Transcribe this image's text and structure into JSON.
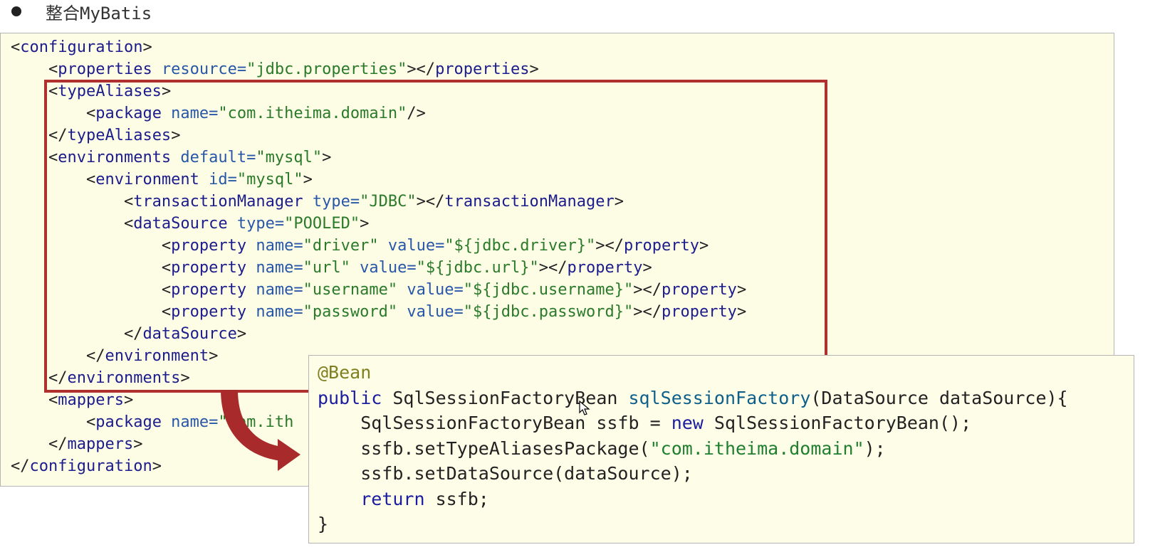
{
  "heading": {
    "text": "整合MyBatis"
  },
  "xml_config": {
    "lines": [
      [
        {
          "t": "<",
          "c": "b"
        },
        {
          "t": "configuration",
          "c": "t"
        },
        {
          "t": ">",
          "c": "b"
        }
      ],
      [
        {
          "t": "    <",
          "c": "b"
        },
        {
          "t": "properties",
          "c": "t"
        },
        {
          "t": " resource=",
          "c": "a"
        },
        {
          "t": "\"jdbc.properties\"",
          "c": "v"
        },
        {
          "t": "></",
          "c": "b"
        },
        {
          "t": "properties",
          "c": "t"
        },
        {
          "t": ">",
          "c": "b"
        }
      ],
      [
        {
          "t": "    <",
          "c": "b"
        },
        {
          "t": "typeAliases",
          "c": "t"
        },
        {
          "t": ">",
          "c": "b"
        }
      ],
      [
        {
          "t": "        <",
          "c": "b"
        },
        {
          "t": "package",
          "c": "t"
        },
        {
          "t": " name=",
          "c": "a"
        },
        {
          "t": "\"com.itheima.domain\"",
          "c": "v"
        },
        {
          "t": "/>",
          "c": "b"
        }
      ],
      [
        {
          "t": "    </",
          "c": "b"
        },
        {
          "t": "typeAliases",
          "c": "t"
        },
        {
          "t": ">",
          "c": "b"
        }
      ],
      [
        {
          "t": "    <",
          "c": "b"
        },
        {
          "t": "environments",
          "c": "t"
        },
        {
          "t": " default=",
          "c": "a"
        },
        {
          "t": "\"mysql\"",
          "c": "v"
        },
        {
          "t": ">",
          "c": "b"
        }
      ],
      [
        {
          "t": "        <",
          "c": "b"
        },
        {
          "t": "environment",
          "c": "t"
        },
        {
          "t": " id=",
          "c": "a"
        },
        {
          "t": "\"mysql\"",
          "c": "v"
        },
        {
          "t": ">",
          "c": "b"
        }
      ],
      [
        {
          "t": "            <",
          "c": "b"
        },
        {
          "t": "transactionManager",
          "c": "t"
        },
        {
          "t": " type=",
          "c": "a"
        },
        {
          "t": "\"JDBC\"",
          "c": "v"
        },
        {
          "t": "></",
          "c": "b"
        },
        {
          "t": "transactionManager",
          "c": "t"
        },
        {
          "t": ">",
          "c": "b"
        }
      ],
      [
        {
          "t": "            <",
          "c": "b"
        },
        {
          "t": "dataSource",
          "c": "t"
        },
        {
          "t": " type=",
          "c": "a"
        },
        {
          "t": "\"POOLED\"",
          "c": "v"
        },
        {
          "t": ">",
          "c": "b"
        }
      ],
      [
        {
          "t": "                <",
          "c": "b"
        },
        {
          "t": "property",
          "c": "t"
        },
        {
          "t": " name=",
          "c": "a"
        },
        {
          "t": "\"driver\"",
          "c": "v"
        },
        {
          "t": " value=",
          "c": "a"
        },
        {
          "t": "\"${jdbc.driver}\"",
          "c": "v"
        },
        {
          "t": "></",
          "c": "b"
        },
        {
          "t": "property",
          "c": "t"
        },
        {
          "t": ">",
          "c": "b"
        }
      ],
      [
        {
          "t": "                <",
          "c": "b"
        },
        {
          "t": "property",
          "c": "t"
        },
        {
          "t": " name=",
          "c": "a"
        },
        {
          "t": "\"url\"",
          "c": "v"
        },
        {
          "t": " value=",
          "c": "a"
        },
        {
          "t": "\"${jdbc.url}\"",
          "c": "v"
        },
        {
          "t": "></",
          "c": "b"
        },
        {
          "t": "property",
          "c": "t"
        },
        {
          "t": ">",
          "c": "b"
        }
      ],
      [
        {
          "t": "                <",
          "c": "b"
        },
        {
          "t": "property",
          "c": "t"
        },
        {
          "t": " name=",
          "c": "a"
        },
        {
          "t": "\"username\"",
          "c": "v"
        },
        {
          "t": " value=",
          "c": "a"
        },
        {
          "t": "\"${jdbc.username}\"",
          "c": "v"
        },
        {
          "t": "></",
          "c": "b"
        },
        {
          "t": "property",
          "c": "t"
        },
        {
          "t": ">",
          "c": "b"
        }
      ],
      [
        {
          "t": "                <",
          "c": "b"
        },
        {
          "t": "property",
          "c": "t"
        },
        {
          "t": " name=",
          "c": "a"
        },
        {
          "t": "\"password\"",
          "c": "v"
        },
        {
          "t": " value=",
          "c": "a"
        },
        {
          "t": "\"${jdbc.password}\"",
          "c": "v"
        },
        {
          "t": "></",
          "c": "b"
        },
        {
          "t": "property",
          "c": "t"
        },
        {
          "t": ">",
          "c": "b"
        }
      ],
      [
        {
          "t": "            </",
          "c": "b"
        },
        {
          "t": "dataSource",
          "c": "t"
        },
        {
          "t": ">",
          "c": "b"
        }
      ],
      [
        {
          "t": "        </",
          "c": "b"
        },
        {
          "t": "environment",
          "c": "t"
        },
        {
          "t": ">",
          "c": "b"
        }
      ],
      [
        {
          "t": "    </",
          "c": "b"
        },
        {
          "t": "environments",
          "c": "t"
        },
        {
          "t": ">",
          "c": "b"
        }
      ],
      [
        {
          "t": "    <",
          "c": "b"
        },
        {
          "t": "mappers",
          "c": "t"
        },
        {
          "t": ">",
          "c": "b"
        }
      ],
      [
        {
          "t": "        <",
          "c": "b"
        },
        {
          "t": "package",
          "c": "t"
        },
        {
          "t": " name=",
          "c": "a"
        },
        {
          "t": "\"com.ith",
          "c": "v"
        }
      ],
      [
        {
          "t": "    </",
          "c": "b"
        },
        {
          "t": "mappers",
          "c": "t"
        },
        {
          "t": ">",
          "c": "b"
        }
      ],
      [
        {
          "t": "</",
          "c": "b"
        },
        {
          "t": "configuration",
          "c": "t"
        },
        {
          "t": ">",
          "c": "b"
        }
      ]
    ]
  },
  "java_config": {
    "lines": [
      [
        {
          "t": "@Bean",
          "c": "ann"
        }
      ],
      [
        {
          "t": "public",
          "c": "kw"
        },
        {
          "t": " SqlSessionFactoryBean ",
          "c": "p"
        },
        {
          "t": "sqlSessionFactory",
          "c": "fn"
        },
        {
          "t": "(DataSource dataSource){",
          "c": "p"
        }
      ],
      [
        {
          "t": "    SqlSessionFactoryBean ssfb = ",
          "c": "p"
        },
        {
          "t": "new",
          "c": "kw"
        },
        {
          "t": " SqlSessionFactoryBean();",
          "c": "p"
        }
      ],
      [
        {
          "t": "    ssfb.setTypeAliasesPackage(",
          "c": "p"
        },
        {
          "t": "\"com.itheima.domain\"",
          "c": "str"
        },
        {
          "t": ");",
          "c": "p"
        }
      ],
      [
        {
          "t": "    ssfb.setDataSource(dataSource);",
          "c": "p"
        }
      ],
      [
        {
          "t": "    ",
          "c": "p"
        },
        {
          "t": "return",
          "c": "kw"
        },
        {
          "t": " ssfb;",
          "c": "p"
        }
      ],
      [
        {
          "t": "}",
          "c": "p"
        }
      ]
    ]
  },
  "colors": {
    "highlight": "#b03030",
    "panel_bg": "#fdfde6",
    "xml_tag": "#1c1c8c",
    "xml_attr": "#2857a8",
    "xml_value": "#2a7a2a"
  }
}
